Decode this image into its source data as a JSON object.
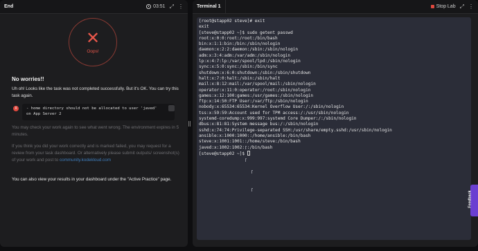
{
  "left": {
    "tab": "End",
    "timer": "03:51",
    "icons": [
      "expand-icon",
      "more-icon"
    ],
    "oops": "Oops!",
    "heading": "No worries!!",
    "p1": "Uh oh! Looks like the task was not completed successfully. But it's OK. You can try this task again.",
    "error": {
      "badge": "X",
      "text": "- home directory should not be allocated to user 'javed' on App Server 2"
    },
    "p2": "You may check your work again to see what went wrong. The environment expires in 5 minutes.",
    "p3_a": "If you think you did your work correctly and is marked failed, you may request for a review from your task dashboard. Or alternatively please submit outputs/ screenshot(s) of your work and post to ",
    "p3_link": "community.kodekloud.com",
    "p4": "You can also view your results in your dashboard under the \"Active Practice\" page."
  },
  "right": {
    "tab": "Terminal 1",
    "stop": "Stop Lab",
    "lines": [
      "[root@stapp02 steve]# exit",
      "exit",
      "[steve@stapp02 ~]$ sudo getent passwd",
      "root:x:0:0:root:/root:/bin/bash",
      "bin:x:1:1:bin:/bin:/sbin/nologin",
      "daemon:x:2:2:daemon:/sbin:/sbin/nologin",
      "adm:x:3:4:adm:/var/adm:/sbin/nologin",
      "lp:x:4:7:lp:/var/spool/lpd:/sbin/nologin",
      "sync:x:5:0:sync:/sbin:/bin/sync",
      "shutdown:x:6:0:shutdown:/sbin:/sbin/shutdown",
      "halt:x:7:0:halt:/sbin:/sbin/halt",
      "mail:x:8:12:mail:/var/spool/mail:/sbin/nologin",
      "operator:x:11:0:operator:/root:/sbin/nologin",
      "games:x:12:100:games:/usr/games:/sbin/nologin",
      "ftp:x:14:50:FTP User:/var/ftp:/sbin/nologin",
      "nobody:x:65534:65534:Kernel Overflow User:/:/sbin/nologin",
      "tss:x:59:59:Account used for TPM access:/:/usr/sbin/nologin",
      "systemd-coredump:x:999:997:systemd Core Dumper:/:/sbin/nologin",
      "dbus:x:81:81:System message bus:/:/sbin/nologin",
      "sshd:x:74:74:Privilege-separated SSH:/usr/share/empty.sshd:/usr/sbin/nologin",
      "ansible:x:1000:1000::/home/ansible:/bin/bash",
      "steve:x:1001:1001::/home/steve:/bin/bash",
      "javed:x:1002:1002:::/bin/bash"
    ],
    "prompt": "[steve@stapp02 ~]$ "
  },
  "feedback": "Feedback"
}
